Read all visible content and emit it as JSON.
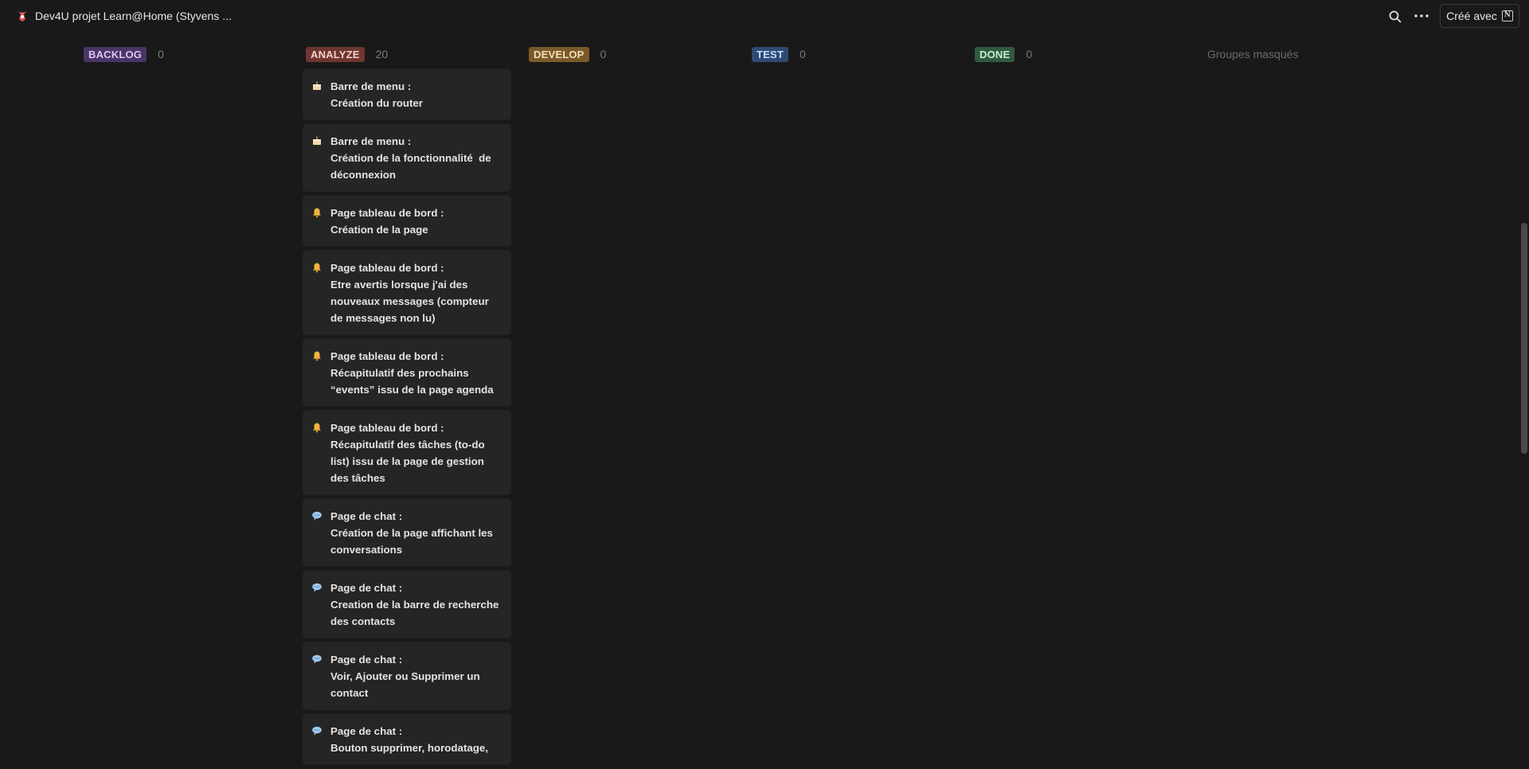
{
  "app": {
    "title": "Dev4U projet Learn@Home (Styvens ...",
    "created_label": "Créé avec"
  },
  "icons": {
    "app_logo": "app-logo-icon",
    "search": "search-icon",
    "more": "more-icon",
    "notion": "notion-icon"
  },
  "columns": [
    {
      "label": "BACKLOG",
      "count": "0",
      "bg": "#4a3566",
      "fg": "#d8c6f0"
    },
    {
      "label": "ANALYZE",
      "count": "20",
      "bg": "#6e3630",
      "fg": "#f3d0cb"
    },
    {
      "label": "DEVELOP",
      "count": "0",
      "bg": "#7a5a2a",
      "fg": "#f2dfb6"
    },
    {
      "label": "TEST",
      "count": "0",
      "bg": "#2e4a72",
      "fg": "#c7dcf5"
    },
    {
      "label": "DONE",
      "count": "0",
      "bg": "#2f5a3e",
      "fg": "#c8ebd2"
    }
  ],
  "hidden_groups_label": "Groupes masqués",
  "cards": [
    {
      "icon": "cake",
      "lines": [
        "Barre de menu :",
        "Création du router"
      ]
    },
    {
      "icon": "cake",
      "lines": [
        "Barre de menu :",
        "Création de la fonctionnalité  de",
        "déconnexion"
      ]
    },
    {
      "icon": "bell",
      "lines": [
        "Page tableau de bord :",
        "Création de la page"
      ]
    },
    {
      "icon": "bell",
      "lines": [
        "Page tableau de bord :",
        "Etre avertis lorsque j'ai des",
        "nouveaux messages (compteur",
        "de messages non lu)"
      ]
    },
    {
      "icon": "bell",
      "lines": [
        "Page tableau de bord :",
        "Récapitulatif des prochains",
        "“events” issu de la page agenda"
      ]
    },
    {
      "icon": "bell",
      "lines": [
        "Page tableau de bord :",
        "Récapitulatif des tâches (to-do",
        "list) issu de la page de gestion",
        "des tâches"
      ]
    },
    {
      "icon": "speech",
      "lines": [
        "Page de chat :",
        "Création de la page affichant les",
        "conversations"
      ]
    },
    {
      "icon": "speech",
      "lines": [
        "Page de chat :",
        "Creation de la barre de recherche",
        "des contacts"
      ]
    },
    {
      "icon": "speech",
      "lines": [
        "Page de chat :",
        "Voir, Ajouter ou Supprimer un",
        "contact"
      ]
    },
    {
      "icon": "speech",
      "lines": [
        "Page de chat :",
        "Bouton supprimer, horodatage,"
      ]
    }
  ]
}
